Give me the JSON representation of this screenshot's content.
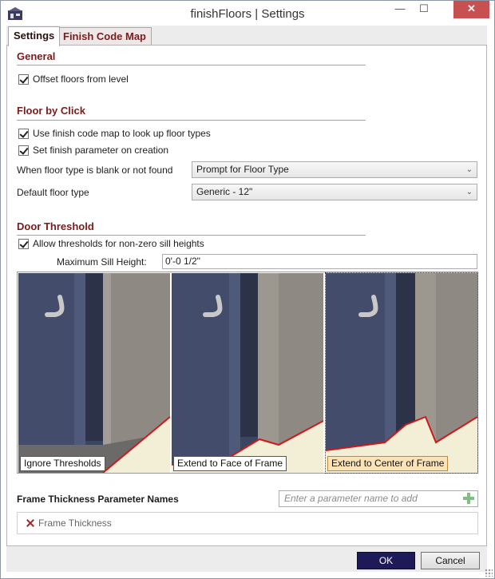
{
  "window": {
    "title": "finishFloors | Settings",
    "minimize_glyph": "—",
    "maximize_glyph": "☐",
    "close_glyph": "✕"
  },
  "tabs": [
    {
      "label": "Settings",
      "active": true
    },
    {
      "label": "Finish Code Map",
      "active": false
    }
  ],
  "general": {
    "title": "General",
    "offset_floors": {
      "label": "Offset floors from level",
      "checked": true
    }
  },
  "floor_by_click": {
    "title": "Floor by Click",
    "use_finish_code_map": {
      "label": "Use finish code map to look up floor types",
      "checked": true
    },
    "set_finish_param": {
      "label": "Set finish parameter on creation",
      "checked": true
    },
    "blank_label": "When floor type is blank or not found",
    "blank_value": "Prompt for Floor Type",
    "default_label": "Default floor type",
    "default_value": "Generic - 12\""
  },
  "door_threshold": {
    "title": "Door Threshold",
    "allow_thresholds": {
      "label": "Allow thresholds for non-zero sill heights",
      "checked": true
    },
    "max_sill_label": "Maximum Sill Height:",
    "max_sill_value": "0'-0 1/2\"",
    "options": [
      {
        "caption": "Ignore Thresholds",
        "selected": false
      },
      {
        "caption": "Extend to Face of Frame",
        "selected": false
      },
      {
        "caption": "Extend to Center of Frame",
        "selected": true
      }
    ]
  },
  "frame_thickness": {
    "title": "Frame Thickness Parameter Names",
    "placeholder": "Enter a parameter name to add",
    "items": [
      "Frame Thickness"
    ]
  },
  "buttons": {
    "ok": "OK",
    "cancel": "Cancel"
  },
  "colors": {
    "accent": "#7a1c1c",
    "ok_button": "#1e1a57",
    "close_button": "#c75050",
    "threshold_line": "#d01818"
  }
}
